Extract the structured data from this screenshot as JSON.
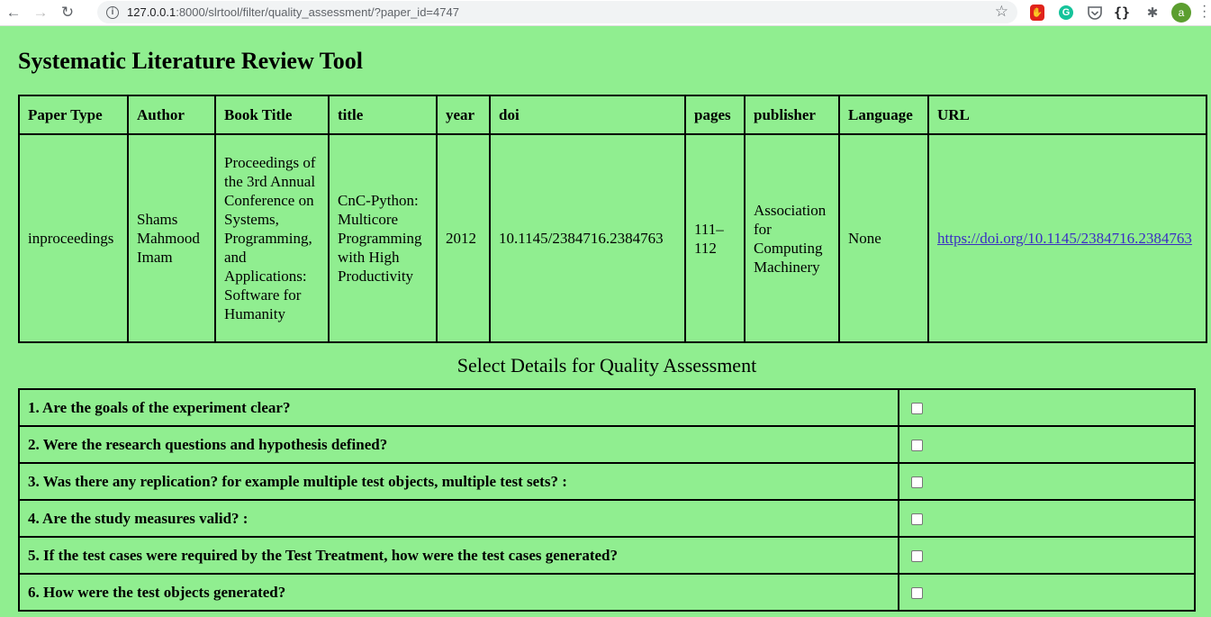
{
  "browser": {
    "url_host": "127.0.0.1",
    "url_path": ":8000/slrtool/filter/quality_assessment/?paper_id=4747",
    "avatar_letter": "a"
  },
  "page": {
    "title": "Systematic Literature Review Tool",
    "qa_heading": "Select Details for Quality Assessment"
  },
  "paper_table": {
    "headers": [
      "Paper Type",
      "Author",
      "Book Title",
      "title",
      "year",
      "doi",
      "pages",
      "publisher",
      "Language",
      "URL"
    ],
    "row": {
      "paper_type": "inproceedings",
      "author": "Shams Mahmood Imam",
      "book_title": "Proceedings of the 3rd Annual Conference on Systems, Programming, and Applications: Software for Humanity",
      "title": "CnC-Python: Multicore Programming with High Productivity",
      "year": "2012",
      "doi": "10.1145/2384716.2384763",
      "pages": "111–112",
      "publisher": "Association for Computing Machinery",
      "language": "None",
      "url": "https://doi.org/10.1145/2384716.2384763"
    }
  },
  "questions": [
    {
      "text": "1. Are the goals of the experiment clear?",
      "checked": false
    },
    {
      "text": "2. Were the research questions and hypothesis defined?",
      "checked": false
    },
    {
      "text": "3. Was there any replication? for example multiple test objects, multiple test sets? :",
      "checked": false
    },
    {
      "text": "4. Are the study measures valid? :",
      "checked": false
    },
    {
      "text": "5. If the test cases were required by the Test Treatment, how were the test cases generated?",
      "checked": false
    },
    {
      "text": "6. How were the test objects generated?",
      "checked": false
    }
  ]
}
